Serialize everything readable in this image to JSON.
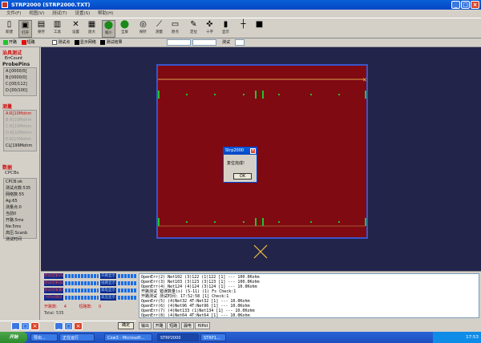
{
  "window": {
    "title": "STRP2000  (STRP2000.TXT)",
    "controls": [
      "_",
      "□",
      "×"
    ]
  },
  "menu": [
    "文件(F)",
    "视图(V)",
    "测试(T)",
    "设置(S)",
    "帮助(H)"
  ],
  "toolbar": [
    {
      "icon": "new-icon",
      "label": "新建"
    },
    {
      "icon": "open-icon",
      "label": "打开"
    },
    {
      "icon": "save-icon",
      "label": "保存"
    },
    {
      "icon": "tools-icon",
      "label": "工具"
    },
    {
      "icon": "settings-icon",
      "label": "设置"
    },
    {
      "icon": "zoom-in-icon",
      "label": "放大"
    },
    {
      "icon": "zoom-out-icon",
      "label": "缩小"
    },
    {
      "icon": "fit-icon",
      "label": "全屏"
    },
    {
      "icon": "probe-icon",
      "label": "探针"
    },
    {
      "icon": "measure-icon",
      "label": "测量"
    },
    {
      "icon": "home-icon",
      "label": "原点"
    },
    {
      "icon": "target-icon",
      "label": "定位"
    },
    {
      "icon": "cross-icon",
      "label": "十字"
    },
    {
      "icon": "monitor-icon",
      "label": "显示"
    }
  ],
  "options": {
    "legend_open": "开路",
    "legend_short": "短路",
    "check1": "测试点",
    "check2": "显示网络",
    "check3": "测试结果",
    "select1": "",
    "select2": "",
    "label3": "测试",
    "select3": ""
  },
  "left_panel": {
    "section1_title": "治具测试",
    "section1_value": "ErrCount",
    "probe_title": "ProbePins",
    "probes": [
      "A:[0000/0]",
      "B:[0000/0]",
      "C:[00/112]",
      "D:[00/100]"
    ],
    "section2_title": "测量",
    "measures": [
      {
        "text": "A:R[10Mohm",
        "state": "active"
      },
      {
        "text": "B:R[10Mohm",
        "state": "dim"
      },
      {
        "text": "C:R[10Mohm",
        "state": "dim"
      },
      {
        "text": "D:R[10Mohm",
        "state": "dim"
      },
      {
        "text": "E:R[10Mohm",
        "state": "dim"
      },
      {
        "text": "CL[199Mohm",
        "state": "normal"
      }
    ],
    "section3_title": "数据",
    "data_head": "CPCBs",
    "data_items": [
      "CPCB:ok",
      "测试点数:535",
      "网络数:55",
      "Ag:65",
      "测量点:0",
      "当前0",
      "开路:5ms",
      "Ne:5ms",
      "高压:Scanb",
      "测试时间",
      "0:0000 NO:259"
    ]
  },
  "dialog": {
    "title": "Strp2000",
    "message": "复位完成!",
    "ok": "OK"
  },
  "meters": [
    {
      "left": "测试结果开路",
      "right": "开路显示"
    },
    {
      "left": "测试结果短路",
      "right": "短路显示"
    },
    {
      "left": "测试结果漏电",
      "right": "漏电显示"
    },
    {
      "left": "HiPot测试",
      "right": "高压显示"
    }
  ],
  "counts": {
    "open_label": "开路数:",
    "open_value": "4",
    "short_label": "短路数:",
    "short_value": "0"
  },
  "total": "Total: 535",
  "log_lines": [
    "OpenErr(2) Net102 (3)122 (1)122 [1]  --- 100.0Kohm",
    "OpenErr(3) Net103 (3)123 (3)123 [1]  --- 100.0Kohm",
    "OpenErr(4) Net124 (4)124 (3)124 [1]  --- 10.0Kohm",
    "开路测试 错误数量(s)  (S-11) (1) Fs Check:1",
    "开路测试 测试时间: 17:52:58 [1] Check:1",
    "OpenErr(5) (4)Net32 4T:Net32 [1]  --- 10.0Kohm",
    "OpenErr(6) (4)Net96 4T:Net96 [1]  --- 10.0Kohm",
    "OpenErr(7) (4)Net133 (1)Net134 [1]  --- 10.0Kohm",
    "OpenErr(8) (4)Net64 4T:Net64 [1]  --- 10.0Kohm"
  ],
  "tabs": [
    "输出",
    "开路",
    "短路",
    "漏电",
    "HiPot"
  ],
  "mini_window": {
    "controls": [
      "_",
      "□",
      "×"
    ],
    "controls2": [
      "_",
      "□",
      "×"
    ],
    "button": "确定"
  },
  "taskbar": {
    "start": "开始",
    "tasks": [
      "导出...",
      "正在运行",
      "Cow3 - Microsoft...",
      "STRP2000",
      "STRP1..."
    ],
    "clock": "17:53"
  },
  "colors": {
    "board": "#7f0a12",
    "background": "#22244a",
    "open": "#21c42a",
    "short": "#e01010"
  }
}
